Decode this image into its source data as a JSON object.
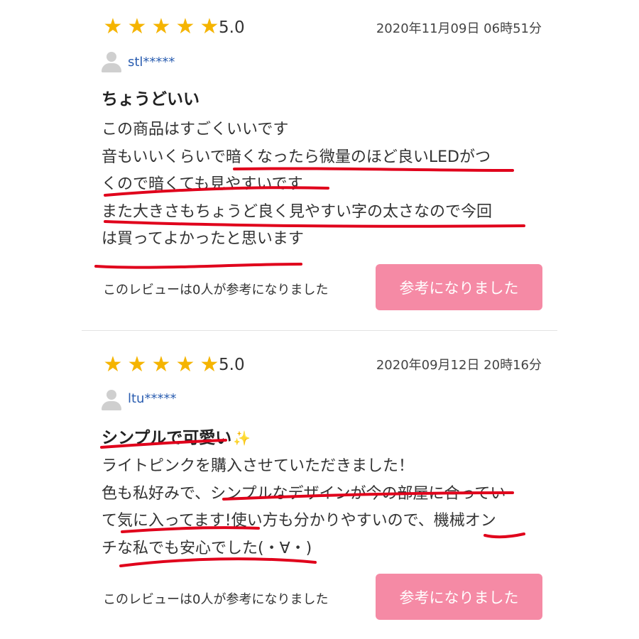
{
  "reviews": [
    {
      "rating_value": "5.0",
      "stars": 5,
      "date": "2020年11月09日 06時51分",
      "username": "stl*****",
      "title": "ちょうどいい",
      "title_suffix": "",
      "body_lines": [
        "この商品はすごくいいです",
        "音もいいくらいで暗くなったら微量のほど良いLEDがつ",
        "くので暗くても見やすいです",
        "また大きさもちょうど良く見やすい字の太さなので今回",
        "は買ってよかったと思います"
      ],
      "helpful_count_text": "このレビューは0人が参考になりました",
      "helpful_button": "参考になりました"
    },
    {
      "rating_value": "5.0",
      "stars": 5,
      "date": "2020年09月12日 20時16分",
      "username": "ltu*****",
      "title": "シンプルで可愛い",
      "title_suffix": "✨",
      "body_lines": [
        "ライトピンクを購入させていただきました！",
        "色も私好みで、シンプルなデザインが今の部屋に合ってい",
        "て気に入ってます!使い方も分かりやすいので、機械オン",
        "チな私でも安心でした(・∀・)"
      ],
      "helpful_count_text": "このレビューは0人が参考になりました",
      "helpful_button": "参考になりました"
    }
  ],
  "colors": {
    "star": "#f5b400",
    "button": "#f58aa5",
    "username": "#2a5db0",
    "annotation": "#e0001b"
  },
  "icons": {
    "star": "star-icon",
    "avatar": "user-avatar-icon",
    "sparkle": "sparkle-icon"
  }
}
